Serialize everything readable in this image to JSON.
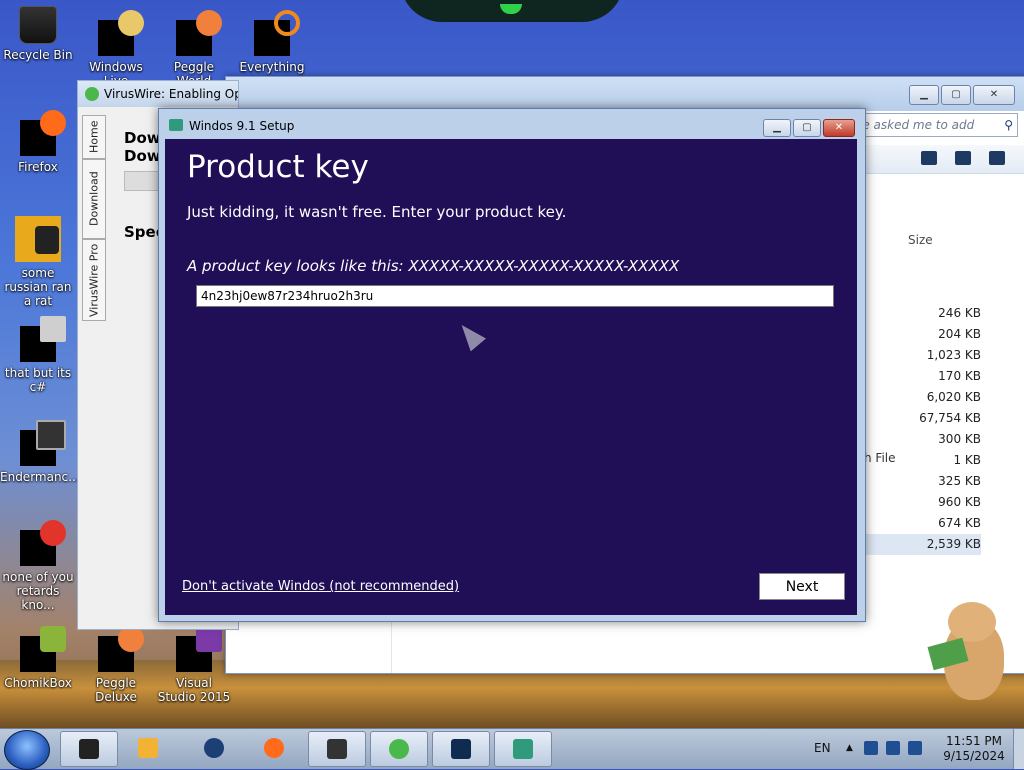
{
  "desktop": {
    "icons": [
      {
        "label": "Recycle Bin"
      },
      {
        "label": "Windows Live"
      },
      {
        "label": "Peggle World"
      },
      {
        "label": "Everything"
      },
      {
        "label": "Firefox"
      },
      {
        "label": "some russian ran a rat"
      },
      {
        "label": "that but its c#"
      },
      {
        "label": "Endermanc..."
      },
      {
        "label": "none of you retards kno..."
      },
      {
        "label": "ChomikBox"
      },
      {
        "label": "Peggle Deluxe"
      },
      {
        "label": "Visual Studio 2015"
      }
    ]
  },
  "explorer": {
    "search_placeholder": "le asked me to add",
    "column_size": "Size",
    "type_fragment": "h File",
    "sizes": [
      "246 KB",
      "204 KB",
      "1,023 KB",
      "170 KB",
      "6,020 KB",
      "67,754 KB",
      "300 KB",
      "1 KB",
      "325 KB",
      "960 KB",
      "674 KB",
      "2,539 KB"
    ]
  },
  "viruswire": {
    "title": "VirusWire: Enabling Op",
    "tabs": [
      "Home",
      "Download",
      "VirusWire Pro"
    ],
    "heading1": "Dow",
    "heading2": "Dow",
    "speed": "Spee"
  },
  "setup": {
    "title": "Windos 9.1 Setup",
    "heading": "Product key",
    "description": "Just kidding, it wasn't free. Enter your product key.",
    "hint": "A product key looks like this: XXXXX-XXXXX-XXXXX-XXXXX-XXXXX",
    "key_value": "4n23hj0ew87r234hruo2h3ru",
    "skip_link": "Don't activate Windos (not recommended)",
    "next_label": "Next"
  },
  "taskbar": {
    "language": "EN",
    "time": "11:51 PM",
    "date": "9/15/2024",
    "colors": {
      "accent": "#200e56"
    }
  }
}
